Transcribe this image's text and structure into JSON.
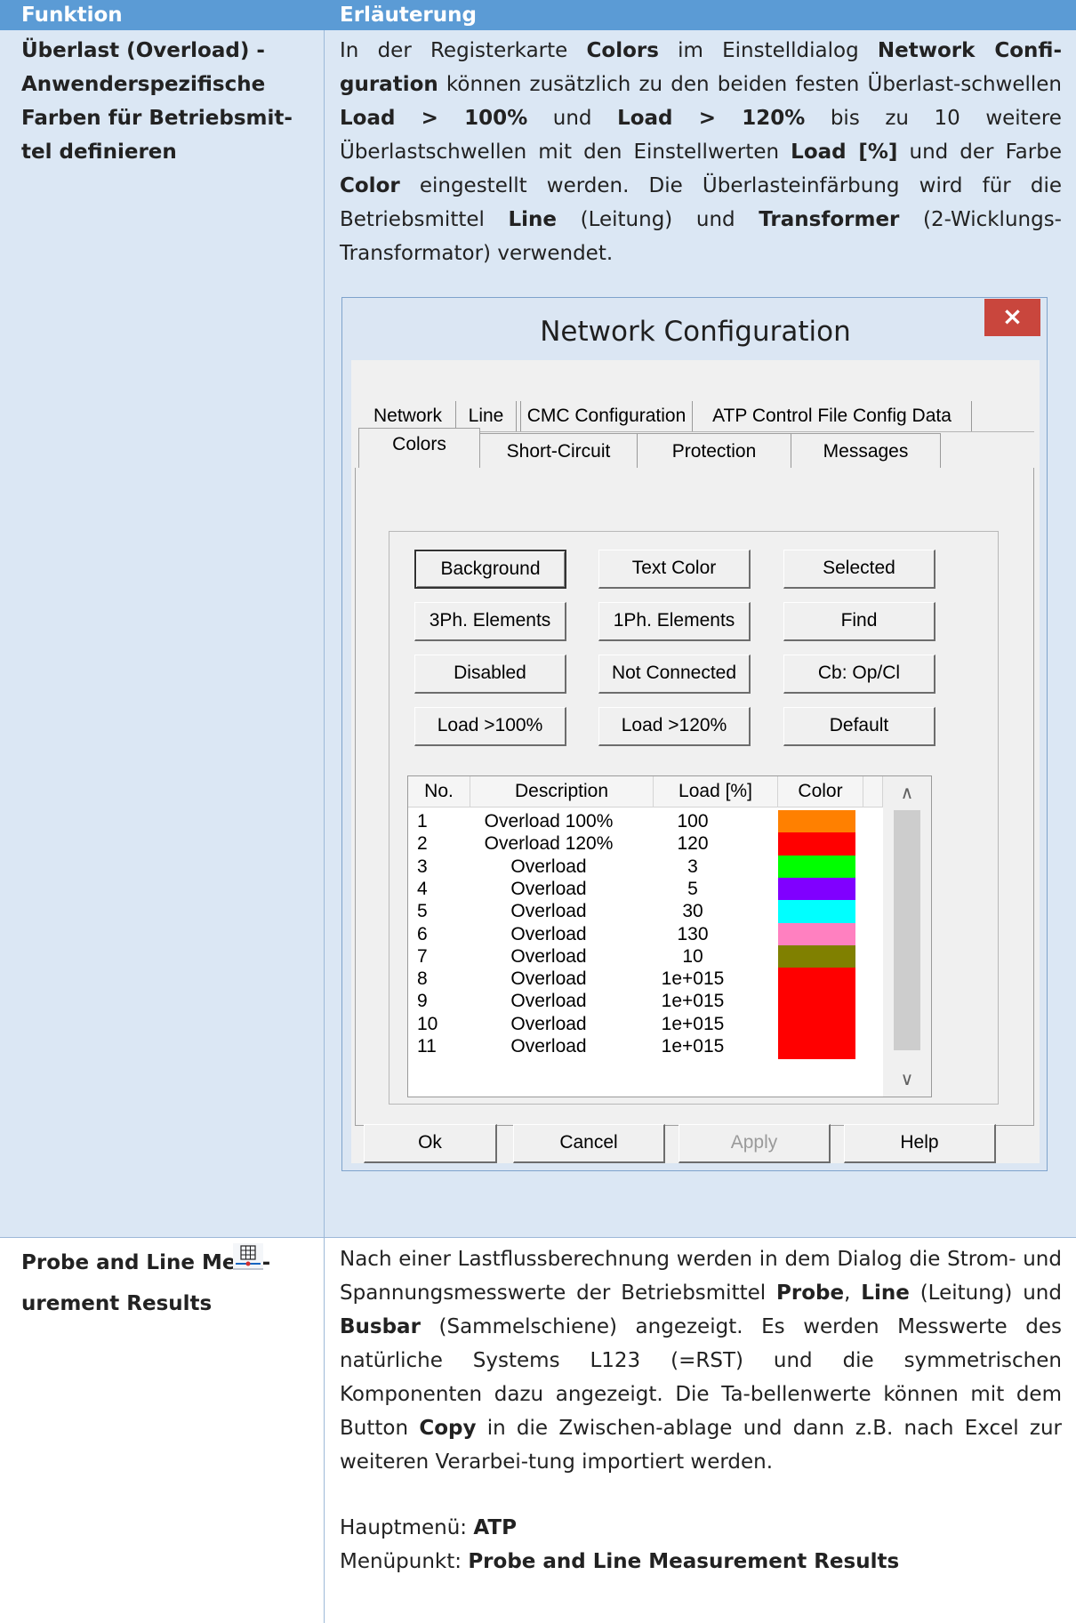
{
  "header": {
    "col1": "Funktion",
    "col2": "Erläuterung"
  },
  "row1": {
    "title_lines": [
      "Überlast (Overload) -",
      "Anwenderspezifische",
      "Farben für Betriebsmit-",
      "tel definieren"
    ],
    "text_html": "In der Registerkarte <b>Colors</b> im Einstelldialog <b>Network Confi-guration</b> können zusätzlich zu den beiden festen Überlast-schwellen <b>Load &gt; 100%</b> und <b>Load &gt; 120%</b> bis zu 10 weitere Überlastschwellen mit den Einstellwerten <b>Load [%]</b> und der Farbe <b>Color</b> eingestellt werden. Die Überlasteinfärbung wird für die Betriebsmittel <b>Line</b> (Leitung) und <b>Transformer</b> (2-Wicklungs-Transformator) verwendet."
  },
  "dialog": {
    "title": "Network Configuration",
    "close": "×",
    "tabs_back": [
      "Network",
      "Line",
      "CMC Configuration",
      "ATP Control File Config Data"
    ],
    "tabs_front": [
      "Colors",
      "Short-Circuit",
      "Protection",
      "Messages"
    ],
    "buttons": [
      [
        "Background",
        "Text Color",
        "Selected"
      ],
      [
        "3Ph. Elements",
        "1Ph. Elements",
        "Find"
      ],
      [
        "Disabled",
        "Not Connected",
        "Cb: Op/Cl"
      ],
      [
        "Load >100%",
        "Load >120%",
        "Default"
      ]
    ],
    "list_headers": [
      "No.",
      "Description",
      "Load [%]",
      "Color"
    ],
    "rows": [
      {
        "no": "1",
        "desc": "Overload 100%",
        "load": "100",
        "color": "#ff8000"
      },
      {
        "no": "2",
        "desc": "Overload 120%",
        "load": "120",
        "color": "#ff0000"
      },
      {
        "no": "3",
        "desc": "Overload",
        "load": "3",
        "color": "#00ff00"
      },
      {
        "no": "4",
        "desc": "Overload",
        "load": "5",
        "color": "#8000ff"
      },
      {
        "no": "5",
        "desc": "Overload",
        "load": "30",
        "color": "#00ffff"
      },
      {
        "no": "6",
        "desc": "Overload",
        "load": "130",
        "color": "#ff80c0"
      },
      {
        "no": "7",
        "desc": "Overload",
        "load": "10",
        "color": "#808000"
      },
      {
        "no": "8",
        "desc": "Overload",
        "load": "1e+015",
        "color": "#ff0000"
      },
      {
        "no": "9",
        "desc": "Overload",
        "load": "1e+015",
        "color": "#ff0000"
      },
      {
        "no": "10",
        "desc": "Overload",
        "load": "1e+015",
        "color": "#ff0000"
      },
      {
        "no": "11",
        "desc": "Overload",
        "load": "1e+015",
        "color": "#ff0000"
      }
    ],
    "footer_buttons": [
      "Ok",
      "Cancel",
      "Apply",
      "Help"
    ]
  },
  "row2": {
    "title_lines": [
      "Probe and Line Meas-",
      "urement Results"
    ],
    "text_html": "Nach einer Lastflussberechnung werden in dem Dialog die Strom- und Spannungsmesswerte der Betriebsmittel <b>Probe</b>, <b>Line</b> (Leitung) und <b>Busbar</b> (Sammelschiene) angezeigt. Es werden Messwerte des natürliche Systems L123 (=RST) und die symmetrischen Komponenten dazu angezeigt. Die Ta-bellenwerte können mit dem Button <b>Copy</b> in die Zwischen-ablage und dann z.B. nach Excel zur weiteren Verarbei-tung importiert werden.",
    "menu_label": "Hauptmenü: ",
    "menu_value": "ATP",
    "item_label": "Menüpunkt: ",
    "item_value": "Probe and Line Measurement Results",
    "icon": "table-probe-icon"
  }
}
